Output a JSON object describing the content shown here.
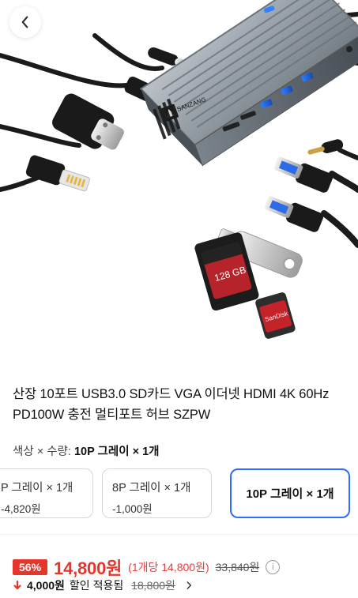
{
  "nav": {
    "back_label": "back"
  },
  "product": {
    "title": "산장 10포트 USB3.0 SD카드 VGA 이더넷 HDMI 4K 60Hz PD100W 충전 멀티포트 허브 SZPW",
    "brand_text": "SANZANG",
    "sd_card_text": "128 GB",
    "microsd_text": "SanDisk"
  },
  "selection": {
    "label": "색상 × 수량:",
    "value": "10P 그레이 × 1개"
  },
  "options": [
    {
      "label": "P 그레이 × 1개",
      "sub": "-4,820원",
      "selected": false
    },
    {
      "label": "8P 그레이 × 1개",
      "sub": "-1,000원",
      "selected": false
    },
    {
      "label": "10P 그레이 × 1개",
      "sub": "",
      "selected": true
    }
  ],
  "pricing": {
    "discount_percent": "56%",
    "price": "14,800원",
    "per_unit": "(1개당 14,800원)",
    "original_price": "33,840원",
    "info_icon": "info-circle-icon"
  },
  "discount_applied": {
    "amount": "4,000원",
    "text": "할인 적용됨",
    "old_price": "18,800원"
  },
  "colors": {
    "accent_blue": "#2f6dff",
    "discount_red": "#e5362c"
  }
}
